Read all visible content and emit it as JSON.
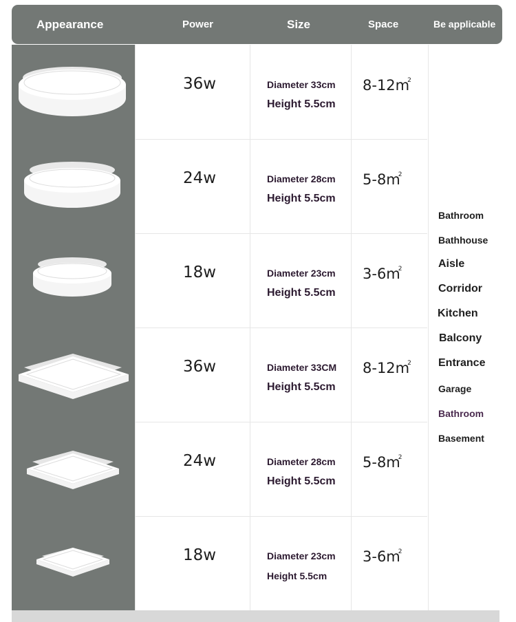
{
  "header": {
    "appearance": "Appearance",
    "power": "Power",
    "size": "Size",
    "space": "Space",
    "applicable": "Be applicable"
  },
  "rows": [
    {
      "shape": "round-lamp",
      "power": "36w",
      "diameter": "Diameter 33cm",
      "height": "Height 5.5cm",
      "space": "8-12m",
      "unit_sup": "2"
    },
    {
      "shape": "round-lamp",
      "power": "24w",
      "diameter": "Diameter 28cm",
      "height": "Height 5.5cm",
      "space": "5-8m",
      "unit_sup": "2"
    },
    {
      "shape": "round-lamp",
      "power": "18w",
      "diameter": "Diameter 23cm",
      "height": "Height 5.5cm",
      "space": "3-6m",
      "unit_sup": "2"
    },
    {
      "shape": "square-lamp",
      "power": "36w",
      "diameter": "Diameter 33CM",
      "height": "Height 5.5cm",
      "space": "8-12m",
      "unit_sup": "2"
    },
    {
      "shape": "square-lamp",
      "power": "24w",
      "diameter": "Diameter 28cm",
      "height": "Height 5.5cm",
      "space": "5-8m",
      "unit_sup": "2"
    },
    {
      "shape": "square-lamp",
      "power": "18w",
      "diameter": "Diameter 23cm",
      "height": "Height 5.5cm",
      "space": "3-6m",
      "unit_sup": "2"
    }
  ],
  "applicable": [
    "Bathroom",
    "Bathhouse",
    "Aisle",
    "Corridor",
    "Kitchen",
    "Balcony",
    "Entrance",
    "Garage",
    "Bathroom",
    "Basement"
  ],
  "colors": {
    "header_bg": "#737875",
    "text_dark_purple": "#2c1a30",
    "highlight_purple": "#4a2a4e"
  }
}
